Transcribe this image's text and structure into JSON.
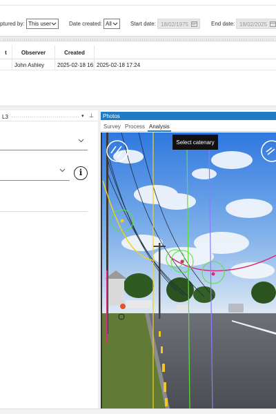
{
  "filters": {
    "captured_by_label": "ptured by:",
    "captured_by_value": "This user",
    "date_created_label": "Date created:",
    "date_created_value": "All",
    "start_date_label": "Start date:",
    "start_date_value": "18/02/1975",
    "end_date_label": "End date:",
    "end_date_value": "18/02/2025"
  },
  "grid": {
    "columns": [
      "t",
      "Observer",
      "Created",
      ""
    ],
    "rows": [
      [
        "",
        "John Ashley",
        "2025-02-18 16:",
        "2025-02-18 17:24"
      ]
    ]
  },
  "left_panel": {
    "title": "L3",
    "caret": "▾",
    "pin": "⊥",
    "info": "i"
  },
  "photos": {
    "title": "Photos",
    "tabs": [
      "Survey",
      "Process",
      "Analysis"
    ],
    "active_tab": "Analysis",
    "tooltip": "Select catenary"
  },
  "icons": [
    "chevron-down-icon",
    "calendar-icon",
    "info-icon",
    "pin-icon",
    "curve-tool-icon"
  ],
  "colors": {
    "accent": "#1e7bc4",
    "catenary_yellow": "#f2d21a",
    "catenary_magenta": "#e0287a",
    "marker_green": "#5fe03a",
    "guide_violet": "#8a7cff"
  }
}
